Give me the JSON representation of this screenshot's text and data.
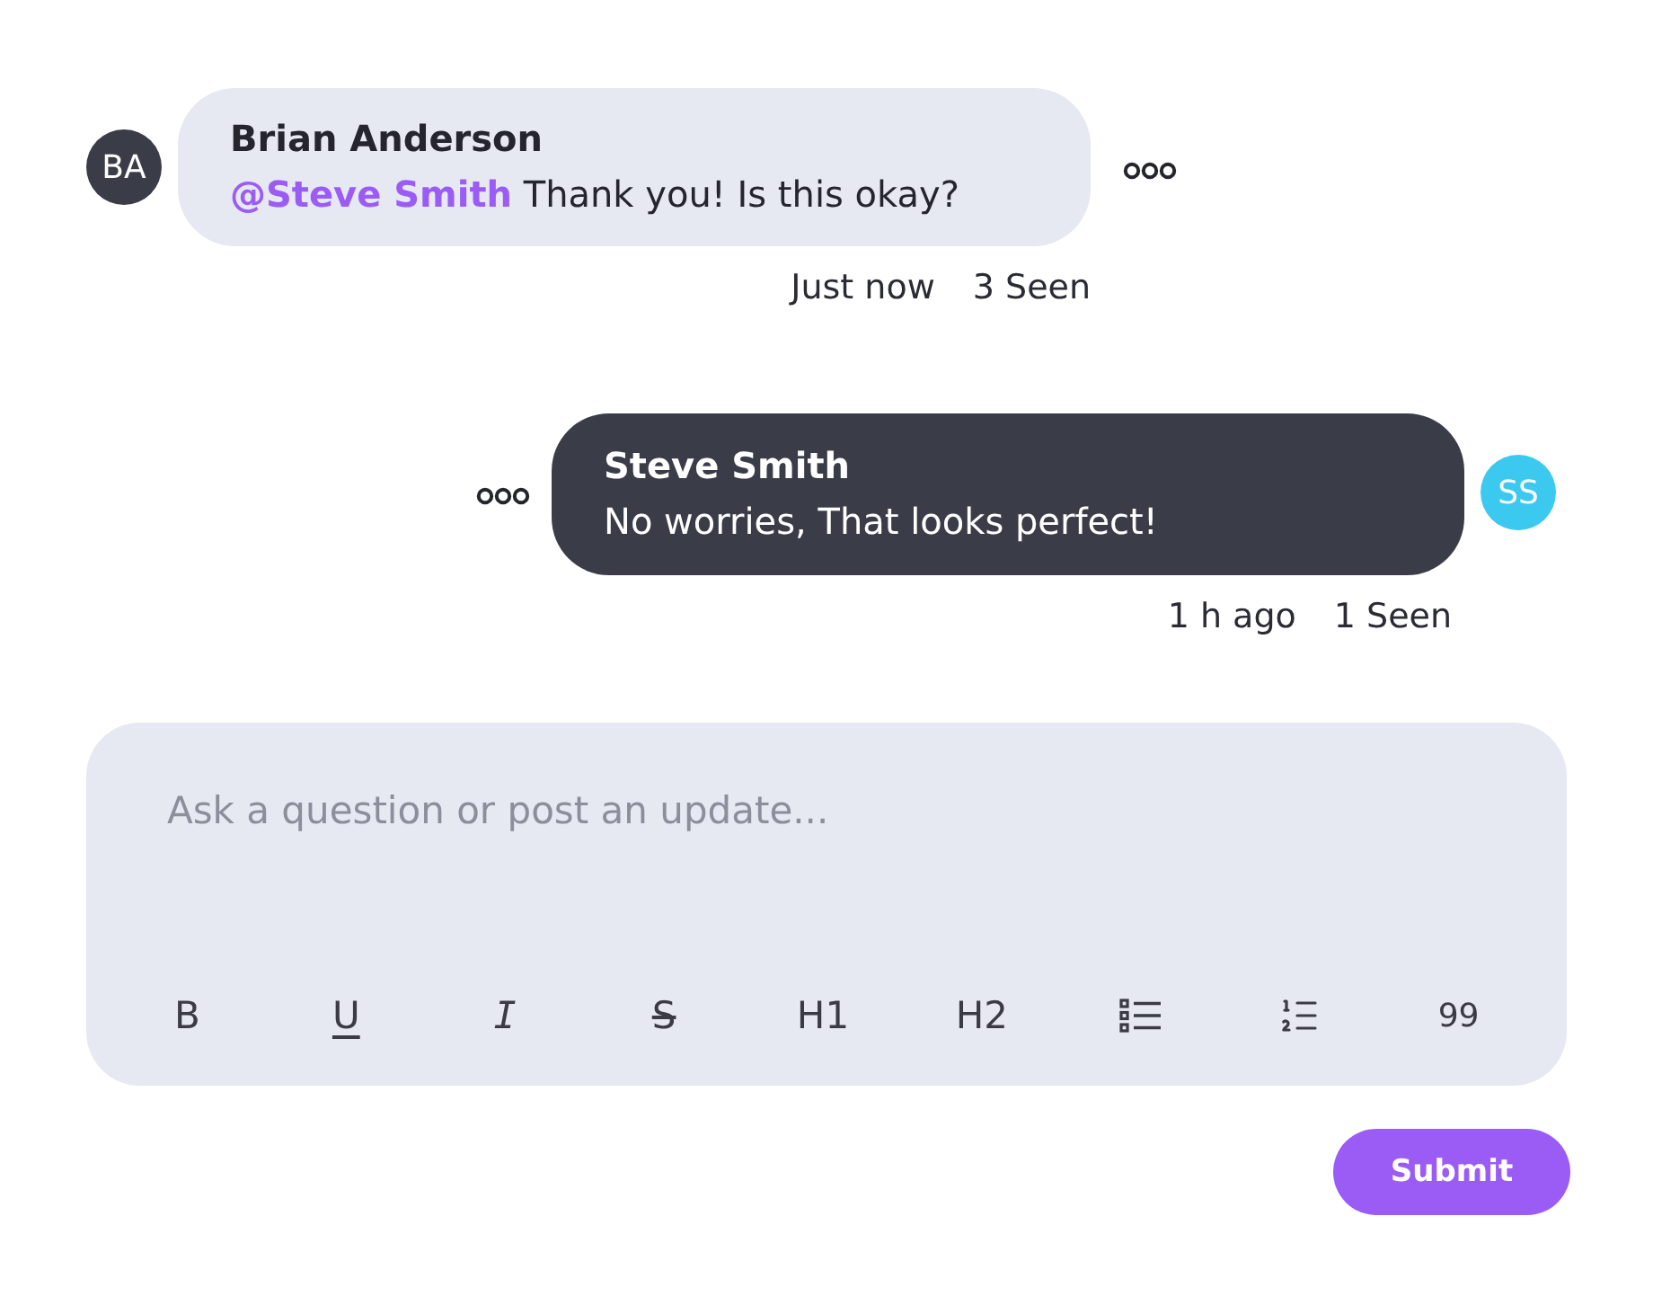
{
  "messages": [
    {
      "kind": "received",
      "author": "Brian Anderson",
      "initials": "BA",
      "color": "#3a3d48",
      "text": "**@Steve Smith** Thank you! Is this okay?",
      "time": "Just now",
      "seen": "3 Seen"
    },
    {
      "kind": "sent",
      "author": "Steve Smith",
      "initials": "SS",
      "color": "#3cc9ef",
      "text": "No worries, That looks perfect!",
      "time": "1 h ago",
      "seen": "1 Seen"
    }
  ],
  "composer": {
    "placeholder": "Ask a question or post an update...",
    "toolbar": [
      {
        "kind": "bold",
        "label": "B"
      },
      {
        "kind": "underline",
        "label": "U"
      },
      {
        "kind": "italic",
        "label": "I"
      },
      {
        "kind": "strike",
        "label": "S"
      },
      {
        "kind": "heading",
        "label": "H1"
      },
      {
        "kind": "heading",
        "label": "H2"
      },
      {
        "kind": "bullet-list"
      },
      {
        "kind": "numbered-list"
      },
      {
        "kind": "quote",
        "label": "99"
      }
    ]
  },
  "submit": "Submit"
}
